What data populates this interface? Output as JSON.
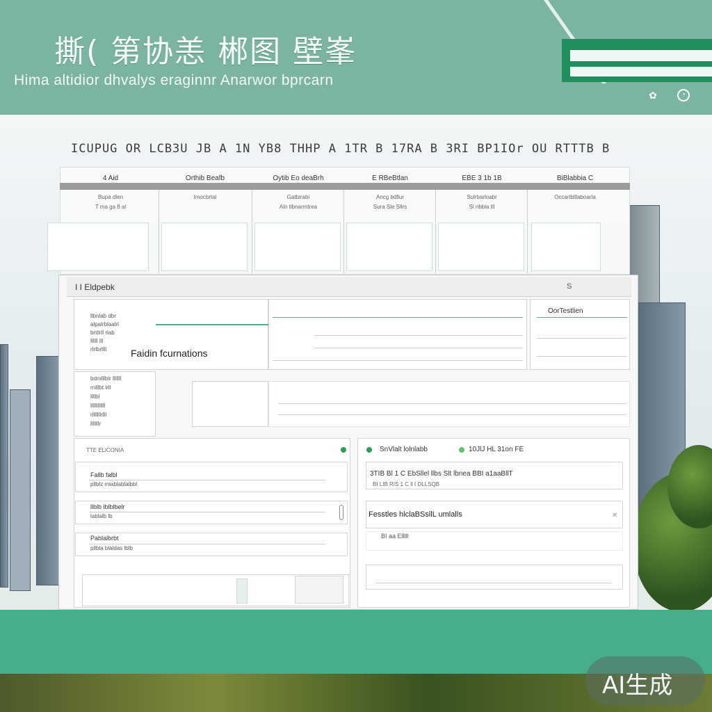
{
  "header": {
    "title": "撕( 第协恙 郴图 壁峯",
    "subtitle": "Hima altidior dhvalys eraginnr Anarwor bprcarn",
    "icons": [
      "flower-icon",
      "clock-icon"
    ]
  },
  "table_heading": "ICUPUG OR LCB3U JB A 1N YB8 THHP A 1TR B 17RA B 3RI BP1IOr OU RTTTB B",
  "columns": [
    {
      "header": "4 Aid",
      "line1": "Bupa dlen",
      "line2": "T ma ga 8 al"
    },
    {
      "header": "Orthib Beafb",
      "line1": "Imocbrtal",
      "line2": ""
    },
    {
      "header": "Oytib Eo deaBrh",
      "line1": "Gatbirabi",
      "line2": "Aln tlbnarmtrea"
    },
    {
      "header": "E RBeBtlan",
      "line1": "Ancg bdllur",
      "line2": "Sura Sle Sllrs"
    },
    {
      "header": "EBE 3 1b 1B",
      "line1": "Sulrbarloabr",
      "line2": "Sl ribbla tll"
    },
    {
      "header": "BiBlabbia C",
      "line1": "Occarlblllaboarla",
      "line2": ""
    }
  ],
  "panel": {
    "top_label": "I I  Eldpebk",
    "top_right": "S",
    "right_tag": "OorTestlien",
    "feature_title": "Faidin fcurnations",
    "feature_lines": [
      "llbnlab dbr",
      "alpalrblaalrl",
      "bntlrll rlab",
      "llllll lll",
      "rlrlbrllll"
    ],
    "left_block_lines": [
      "bdmlllblr lllllll",
      "rnlllbt lrll",
      "llllbl",
      "llllllllllll",
      "rlllllllrlll",
      "lllllllr"
    ]
  },
  "left_panel": {
    "header": "TTE ELlCONIA",
    "rows": [
      {
        "title": "Fallb falbl",
        "sub": "pllblz mlablablalbbl"
      },
      {
        "title": "llblb lblblbelr",
        "sub": "lablalb lb"
      },
      {
        "title": "Pablalbrbt",
        "sub": "pllbla blaldas lblb"
      }
    ]
  },
  "right_panel": {
    "header_a": "SnVlalt lolnlabb",
    "header_b": "10JlJ HL 31on FE",
    "rows": [
      "3TIB Bl 1 C EbSllel llbs Slt lbnea BBI a1aaBllT",
      "BI LIB RIS 1 C ll I DLLSQB",
      "Fesstles hlclaBSsllL umlalls",
      "BI aa Elllll"
    ]
  },
  "badge": "AI生成",
  "colors": {
    "accent": "#46ae8a",
    "header": "#7bb5a1",
    "brand": "#1f8f5c"
  }
}
